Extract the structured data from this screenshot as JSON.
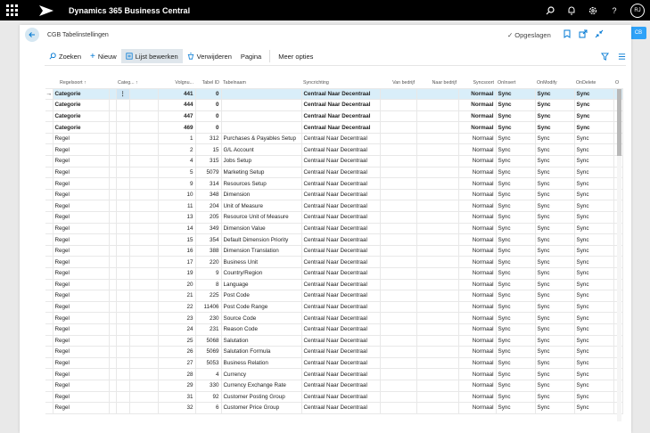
{
  "topbar": {
    "app_title": "Dynamics 365 Business Central",
    "user_initials": "RJ"
  },
  "side_badge": "CB",
  "page": {
    "title": "CGB Tabelinstellingen",
    "saved_label": "Opgeslagen"
  },
  "actions": {
    "search": "Zoeken",
    "new": "Nieuw",
    "edit_list": "Lijst bewerken",
    "delete": "Verwijderen",
    "page": "Pagina",
    "more": "Meer opties"
  },
  "columns": {
    "regelsoort": "Regelsoort ↑",
    "categorie": "Categ... ↑",
    "volgnummer": "Volgnu...",
    "tabel_id": "Tabel ID",
    "tabelnaam": "Tabelnaam",
    "syncrichting": "Syncrichting",
    "van_bedrijf": "Van bedrijf",
    "naar_bedrijf": "Naar bedrijf",
    "syncsoort": "Syncsoort",
    "oninsert": "OnInsert",
    "onmodify": "OnModify",
    "ondelete": "OnDelete",
    "extra": "O"
  },
  "rows": [
    {
      "soort": "Categorie",
      "volg": "441",
      "tid": "0",
      "naam": "",
      "richting": "Centraal Naar Decentraal",
      "syncsoort": "Normaal",
      "ins": "Sync",
      "mod": "Sync",
      "del": "Sync",
      "bold": true
    },
    {
      "soort": "Categorie",
      "volg": "444",
      "tid": "0",
      "naam": "",
      "richting": "Centraal Naar Decentraal",
      "syncsoort": "Normaal",
      "ins": "Sync",
      "mod": "Sync",
      "del": "Sync",
      "bold": true
    },
    {
      "soort": "Categorie",
      "volg": "447",
      "tid": "0",
      "naam": "",
      "richting": "Centraal Naar Decentraal",
      "syncsoort": "Normaal",
      "ins": "Sync",
      "mod": "Sync",
      "del": "Sync",
      "bold": true
    },
    {
      "soort": "Categorie",
      "volg": "469",
      "tid": "0",
      "naam": "",
      "richting": "Centraal Naar Decentraal",
      "syncsoort": "Normaal",
      "ins": "Sync",
      "mod": "Sync",
      "del": "Sync",
      "bold": true
    },
    {
      "soort": "Regel",
      "volg": "1",
      "tid": "312",
      "naam": "Purchases & Payables Setup",
      "richting": "Centraal Naar Decentraal",
      "syncsoort": "Normaal",
      "ins": "Sync",
      "mod": "Sync",
      "del": "Sync"
    },
    {
      "soort": "Regel",
      "volg": "2",
      "tid": "15",
      "naam": "G/L Account",
      "richting": "Centraal Naar Decentraal",
      "syncsoort": "Normaal",
      "ins": "Sync",
      "mod": "Sync",
      "del": "Sync"
    },
    {
      "soort": "Regel",
      "volg": "4",
      "tid": "315",
      "naam": "Jobs Setup",
      "richting": "Centraal Naar Decentraal",
      "syncsoort": "Normaal",
      "ins": "Sync",
      "mod": "Sync",
      "del": "Sync"
    },
    {
      "soort": "Regel",
      "volg": "5",
      "tid": "5079",
      "naam": "Marketing Setup",
      "richting": "Centraal Naar Decentraal",
      "syncsoort": "Normaal",
      "ins": "Sync",
      "mod": "Sync",
      "del": "Sync"
    },
    {
      "soort": "Regel",
      "volg": "9",
      "tid": "314",
      "naam": "Resources Setup",
      "richting": "Centraal Naar Decentraal",
      "syncsoort": "Normaal",
      "ins": "Sync",
      "mod": "Sync",
      "del": "Sync"
    },
    {
      "soort": "Regel",
      "volg": "10",
      "tid": "348",
      "naam": "Dimension",
      "richting": "Centraal Naar Decentraal",
      "syncsoort": "Normaal",
      "ins": "Sync",
      "mod": "Sync",
      "del": "Sync"
    },
    {
      "soort": "Regel",
      "volg": "11",
      "tid": "204",
      "naam": "Unit of Measure",
      "richting": "Centraal Naar Decentraal",
      "syncsoort": "Normaal",
      "ins": "Sync",
      "mod": "Sync",
      "del": "Sync"
    },
    {
      "soort": "Regel",
      "volg": "13",
      "tid": "205",
      "naam": "Resource Unit of Measure",
      "richting": "Centraal Naar Decentraal",
      "syncsoort": "Normaal",
      "ins": "Sync",
      "mod": "Sync",
      "del": "Sync"
    },
    {
      "soort": "Regel",
      "volg": "14",
      "tid": "349",
      "naam": "Dimension Value",
      "richting": "Centraal Naar Decentraal",
      "syncsoort": "Normaal",
      "ins": "Sync",
      "mod": "Sync",
      "del": "Sync"
    },
    {
      "soort": "Regel",
      "volg": "15",
      "tid": "354",
      "naam": "Default Dimension Priority",
      "richting": "Centraal Naar Decentraal",
      "syncsoort": "Normaal",
      "ins": "Sync",
      "mod": "Sync",
      "del": "Sync"
    },
    {
      "soort": "Regel",
      "volg": "16",
      "tid": "388",
      "naam": "Dimension Translation",
      "richting": "Centraal Naar Decentraal",
      "syncsoort": "Normaal",
      "ins": "Sync",
      "mod": "Sync",
      "del": "Sync"
    },
    {
      "soort": "Regel",
      "volg": "17",
      "tid": "220",
      "naam": "Business Unit",
      "richting": "Centraal Naar Decentraal",
      "syncsoort": "Normaal",
      "ins": "Sync",
      "mod": "Sync",
      "del": "Sync"
    },
    {
      "soort": "Regel",
      "volg": "19",
      "tid": "9",
      "naam": "Country/Region",
      "richting": "Centraal Naar Decentraal",
      "syncsoort": "Normaal",
      "ins": "Sync",
      "mod": "Sync",
      "del": "Sync"
    },
    {
      "soort": "Regel",
      "volg": "20",
      "tid": "8",
      "naam": "Language",
      "richting": "Centraal Naar Decentraal",
      "syncsoort": "Normaal",
      "ins": "Sync",
      "mod": "Sync",
      "del": "Sync"
    },
    {
      "soort": "Regel",
      "volg": "21",
      "tid": "225",
      "naam": "Post Code",
      "richting": "Centraal Naar Decentraal",
      "syncsoort": "Normaal",
      "ins": "Sync",
      "mod": "Sync",
      "del": "Sync"
    },
    {
      "soort": "Regel",
      "volg": "22",
      "tid": "11406",
      "naam": "Post Code Range",
      "richting": "Centraal Naar Decentraal",
      "syncsoort": "Normaal",
      "ins": "Sync",
      "mod": "Sync",
      "del": "Sync"
    },
    {
      "soort": "Regel",
      "volg": "23",
      "tid": "230",
      "naam": "Source Code",
      "richting": "Centraal Naar Decentraal",
      "syncsoort": "Normaal",
      "ins": "Sync",
      "mod": "Sync",
      "del": "Sync"
    },
    {
      "soort": "Regel",
      "volg": "24",
      "tid": "231",
      "naam": "Reason Code",
      "richting": "Centraal Naar Decentraal",
      "syncsoort": "Normaal",
      "ins": "Sync",
      "mod": "Sync",
      "del": "Sync"
    },
    {
      "soort": "Regel",
      "volg": "25",
      "tid": "5068",
      "naam": "Salutation",
      "richting": "Centraal Naar Decentraal",
      "syncsoort": "Normaal",
      "ins": "Sync",
      "mod": "Sync",
      "del": "Sync"
    },
    {
      "soort": "Regel",
      "volg": "26",
      "tid": "5069",
      "naam": "Salutation Formula",
      "richting": "Centraal Naar Decentraal",
      "syncsoort": "Normaal",
      "ins": "Sync",
      "mod": "Sync",
      "del": "Sync"
    },
    {
      "soort": "Regel",
      "volg": "27",
      "tid": "5053",
      "naam": "Business Relation",
      "richting": "Centraal Naar Decentraal",
      "syncsoort": "Normaal",
      "ins": "Sync",
      "mod": "Sync",
      "del": "Sync"
    },
    {
      "soort": "Regel",
      "volg": "28",
      "tid": "4",
      "naam": "Currency",
      "richting": "Centraal Naar Decentraal",
      "syncsoort": "Normaal",
      "ins": "Sync",
      "mod": "Sync",
      "del": "Sync"
    },
    {
      "soort": "Regel",
      "volg": "29",
      "tid": "330",
      "naam": "Currency Exchange Rate",
      "richting": "Centraal Naar Decentraal",
      "syncsoort": "Normaal",
      "ins": "Sync",
      "mod": "Sync",
      "del": "Sync"
    },
    {
      "soort": "Regel",
      "volg": "31",
      "tid": "92",
      "naam": "Customer Posting Group",
      "richting": "Centraal Naar Decentraal",
      "syncsoort": "Normaal",
      "ins": "Sync",
      "mod": "Sync",
      "del": "Sync"
    },
    {
      "soort": "Regel",
      "volg": "32",
      "tid": "6",
      "naam": "Customer Price Group",
      "richting": "Centraal Naar Decentraal",
      "syncsoort": "Normaal",
      "ins": "Sync",
      "mod": "Sync",
      "del": "Sync"
    }
  ],
  "colors": {
    "accent": "#0078d4",
    "selected_row": "#d9eef9",
    "topbar": "#000000"
  }
}
